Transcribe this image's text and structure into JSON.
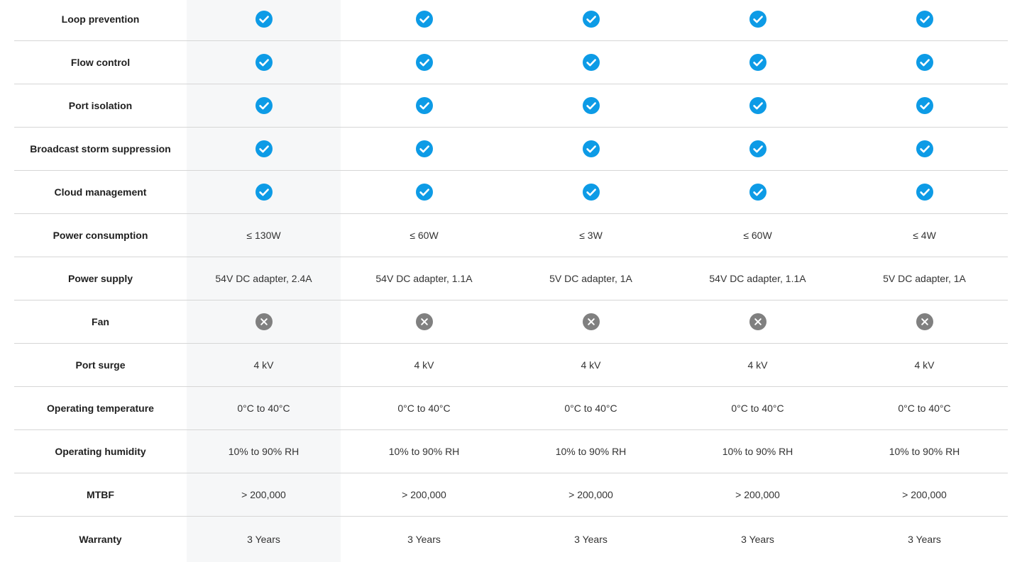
{
  "colors": {
    "check": "#0d9be6",
    "cross": "#808080",
    "highlight_column": "#f6f7f8",
    "divider": "#d6d6d6"
  },
  "rows": [
    {
      "label": "Loop prevention",
      "cells": [
        {
          "icon": "check-icon"
        },
        {
          "icon": "check-icon"
        },
        {
          "icon": "check-icon"
        },
        {
          "icon": "check-icon"
        },
        {
          "icon": "check-icon"
        }
      ]
    },
    {
      "label": "Flow control",
      "cells": [
        {
          "icon": "check-icon"
        },
        {
          "icon": "check-icon"
        },
        {
          "icon": "check-icon"
        },
        {
          "icon": "check-icon"
        },
        {
          "icon": "check-icon"
        }
      ]
    },
    {
      "label": "Port isolation",
      "cells": [
        {
          "icon": "check-icon"
        },
        {
          "icon": "check-icon"
        },
        {
          "icon": "check-icon"
        },
        {
          "icon": "check-icon"
        },
        {
          "icon": "check-icon"
        }
      ]
    },
    {
      "label": "Broadcast storm suppression",
      "cells": [
        {
          "icon": "check-icon"
        },
        {
          "icon": "check-icon"
        },
        {
          "icon": "check-icon"
        },
        {
          "icon": "check-icon"
        },
        {
          "icon": "check-icon"
        }
      ]
    },
    {
      "label": "Cloud management",
      "cells": [
        {
          "icon": "check-icon"
        },
        {
          "icon": "check-icon"
        },
        {
          "icon": "check-icon"
        },
        {
          "icon": "check-icon"
        },
        {
          "icon": "check-icon"
        }
      ]
    },
    {
      "label": "Power consumption",
      "cells": [
        {
          "text": "≤ 130W"
        },
        {
          "text": "≤ 60W"
        },
        {
          "text": "≤ 3W"
        },
        {
          "text": "≤ 60W"
        },
        {
          "text": "≤ 4W"
        }
      ]
    },
    {
      "label": "Power supply",
      "cells": [
        {
          "text": "54V DC adapter, 2.4A"
        },
        {
          "text": "54V DC adapter, 1.1A"
        },
        {
          "text": "5V DC adapter, 1A"
        },
        {
          "text": "54V DC adapter, 1.1A"
        },
        {
          "text": "5V DC adapter, 1A"
        }
      ]
    },
    {
      "label": "Fan",
      "cells": [
        {
          "icon": "cross-icon"
        },
        {
          "icon": "cross-icon"
        },
        {
          "icon": "cross-icon"
        },
        {
          "icon": "cross-icon"
        },
        {
          "icon": "cross-icon"
        }
      ]
    },
    {
      "label": "Port surge",
      "cells": [
        {
          "text": "4 kV"
        },
        {
          "text": "4 kV"
        },
        {
          "text": "4 kV"
        },
        {
          "text": "4 kV"
        },
        {
          "text": "4 kV"
        }
      ]
    },
    {
      "label": "Operating temperature",
      "cells": [
        {
          "text": "0°C to 40°C"
        },
        {
          "text": "0°C to 40°C"
        },
        {
          "text": "0°C to 40°C"
        },
        {
          "text": "0°C to 40°C"
        },
        {
          "text": "0°C to 40°C"
        }
      ]
    },
    {
      "label": "Operating humidity",
      "cells": [
        {
          "text": "10% to 90% RH"
        },
        {
          "text": "10% to 90% RH"
        },
        {
          "text": "10% to 90% RH"
        },
        {
          "text": "10% to 90% RH"
        },
        {
          "text": "10% to 90% RH"
        }
      ]
    },
    {
      "label": "MTBF",
      "cells": [
        {
          "text": "> 200,000"
        },
        {
          "text": "> 200,000"
        },
        {
          "text": "> 200,000"
        },
        {
          "text": "> 200,000"
        },
        {
          "text": "> 200,000"
        }
      ]
    },
    {
      "label": "Warranty",
      "cells": [
        {
          "text": "3 Years"
        },
        {
          "text": "3 Years"
        },
        {
          "text": "3 Years"
        },
        {
          "text": "3 Years"
        },
        {
          "text": "3 Years"
        }
      ]
    }
  ]
}
